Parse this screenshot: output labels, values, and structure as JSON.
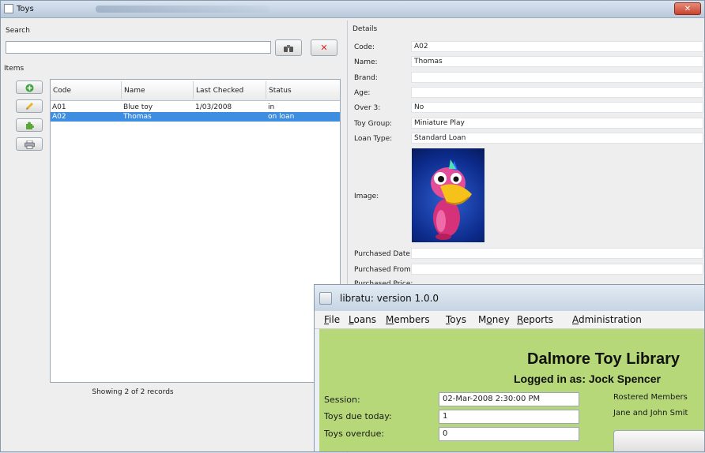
{
  "toys_window": {
    "title": "Toys",
    "search_label": "Search",
    "search_value": "",
    "items_label": "Items",
    "table": {
      "headers": [
        "Code",
        "Name",
        "Last Checked",
        "Status"
      ],
      "rows": [
        [
          "A01",
          "Blue toy",
          "1/03/2008",
          "in"
        ],
        [
          "A02",
          "Thomas",
          "",
          "on loan"
        ]
      ]
    },
    "footer": "Showing 2 of 2 records",
    "details": {
      "header": "Details",
      "fields": [
        {
          "label": "Code:",
          "value": "A02"
        },
        {
          "label": "Name:",
          "value": "Thomas"
        },
        {
          "label": "Brand:",
          "value": ""
        },
        {
          "label": "Age:",
          "value": ""
        },
        {
          "label": "Over 3:",
          "value": "No"
        },
        {
          "label": "Toy Group:",
          "value": "Miniature Play"
        },
        {
          "label": "Loan Type:",
          "value": "Standard Loan"
        }
      ],
      "image_label": "Image:",
      "purchased_date_label": "Purchased Date:",
      "purchased_from_label": "Purchased From:",
      "purchased_price_label": "Purchased Price:"
    }
  },
  "main_window": {
    "title": "libratu: version 1.0.0",
    "menu": [
      "File",
      "Loans",
      "Members",
      "Toys",
      "Money",
      "Reports",
      "Administration"
    ],
    "library_name": "Dalmore Toy Library",
    "logged_in": "Logged in as: Jock Spencer",
    "session_label": "Session:",
    "session_value": "02-Mar-2008 2:30:00 PM",
    "due_label": "Toys due today:",
    "due_value": "1",
    "overdue_label": "Toys overdue:",
    "overdue_value": "0",
    "rostered_label": "Rostered Members",
    "rostered_value": "Jane and John Smit"
  },
  "colors": {
    "selection": "#3d8ee0",
    "panel_green": "#b6d878",
    "close_red": "#c8442c"
  }
}
